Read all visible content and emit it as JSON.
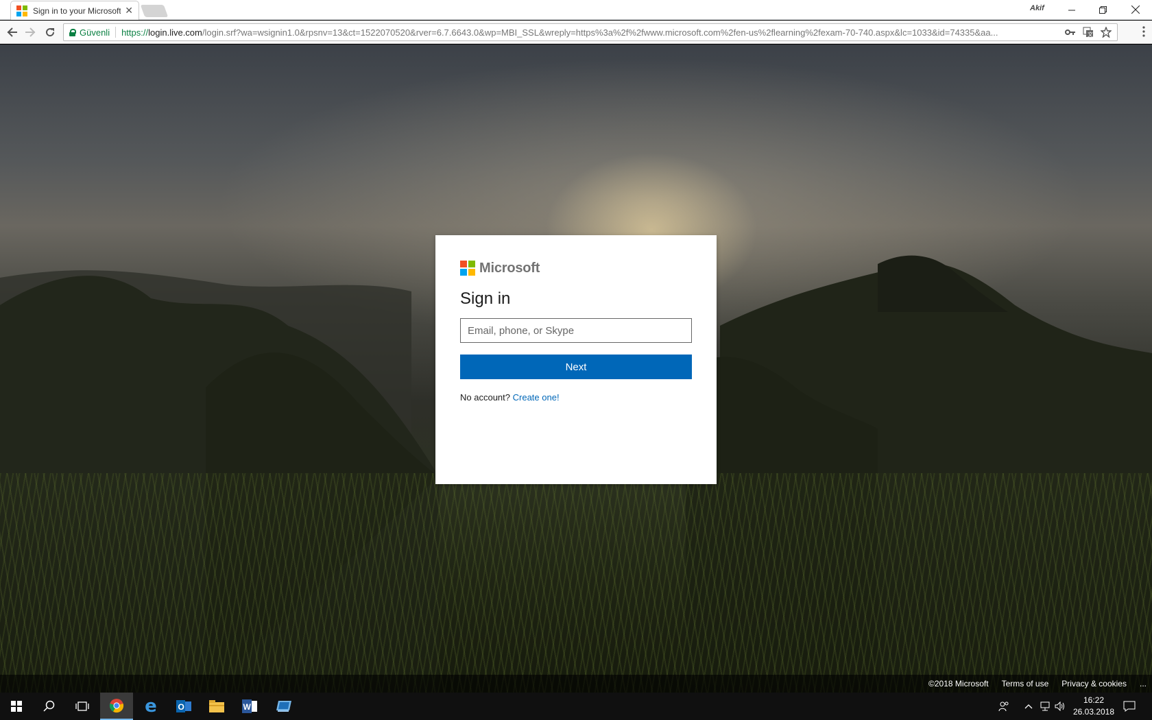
{
  "browser": {
    "tab_title": "Sign in to your Microsoft",
    "tab_close": "✕",
    "profile_name": "Akif",
    "secure_label": "Güvenli",
    "url_scheme": "https://",
    "url_host": "login.live.com",
    "url_path": "/login.srf?wa=wsignin1.0&rpsnv=13&ct=1522070520&rver=6.7.6643.0&wp=MBI_SSL&wreply=https%3a%2f%2fwww.microsoft.com%2fen-us%2flearning%2fexam-70-740.aspx&lc=1033&id=74335&aa...",
    "icons": {
      "back": "back-arrow-icon",
      "forward": "forward-arrow-icon",
      "reload": "reload-icon",
      "key": "key-icon",
      "translate": "translate-icon",
      "bookmark": "star-icon",
      "menu": "kebab-menu-icon"
    }
  },
  "signin": {
    "brand": "Microsoft",
    "title": "Sign in",
    "email_placeholder": "Email, phone, or Skype",
    "email_value": "",
    "next_label": "Next",
    "no_account_text": "No account?",
    "create_link": "Create one!"
  },
  "footer": {
    "copyright": "©2018 Microsoft",
    "terms": "Terms of use",
    "privacy": "Privacy & cookies",
    "more": "..."
  },
  "taskbar": {
    "apps": [
      "start",
      "search",
      "task-view",
      "chrome",
      "edge",
      "outlook",
      "file-explorer",
      "word",
      "remote-desktop"
    ],
    "time": "16:22",
    "date": "26.03.2018"
  },
  "colors": {
    "accent": "#0067b8",
    "secure_green": "#0b8043",
    "ms_red": "#f25022",
    "ms_green": "#7fba00",
    "ms_blue": "#00a4ef",
    "ms_yellow": "#ffb900"
  }
}
